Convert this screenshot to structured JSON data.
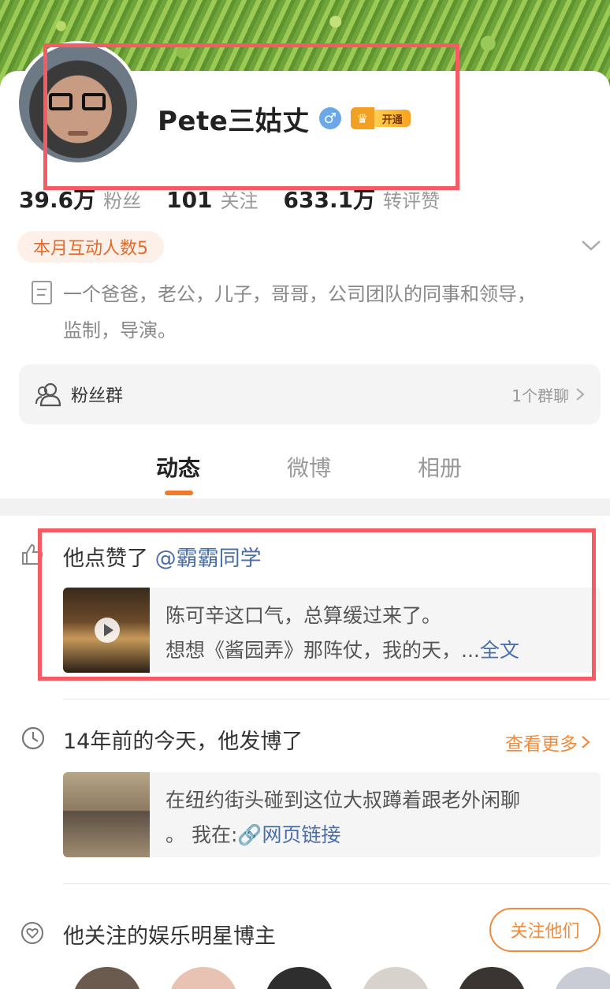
{
  "profile": {
    "name": "Pete三姑丈",
    "gender_symbol": "♂",
    "vip_label": "开通"
  },
  "stats": [
    {
      "value": "39.6万",
      "label": "粉丝"
    },
    {
      "value": "101",
      "label": "关注"
    },
    {
      "value": "633.1万",
      "label": "转评赞"
    }
  ],
  "interaction": {
    "label": "本月互动人数5"
  },
  "bio": {
    "text": "一个爸爸，老公，儿子，哥哥，公司团队的同事和领导，监制，导演。"
  },
  "fan_group": {
    "label": "粉丝群",
    "count": "1个群聊"
  },
  "tabs": [
    {
      "label": "动态",
      "active": true
    },
    {
      "label": "微博",
      "active": false
    },
    {
      "label": "相册",
      "active": false
    }
  ],
  "feed": {
    "liked": {
      "prefix": "他点赞了",
      "mention": "@霸霸同学",
      "line1": "陈可辛这口气，总算缓过来了。",
      "line2": "想想《酱园弄》那阵仗，我的天，",
      "ellipsis": "...",
      "more": "全文"
    },
    "memory": {
      "title": "14年前的今天，他发博了",
      "see_more": "查看更多",
      "line1": "在纽约街头碰到这位大叔蹲着跟老外闲聊",
      "line2_prefix": "。 我在:",
      "link": "网页链接"
    },
    "follows": {
      "title": "他关注的娱乐明星博主",
      "button": "关注他们"
    }
  },
  "colors": {
    "accent": "#f08a3c",
    "link": "#4a6fa8",
    "highlight_box": "#f45b62"
  }
}
